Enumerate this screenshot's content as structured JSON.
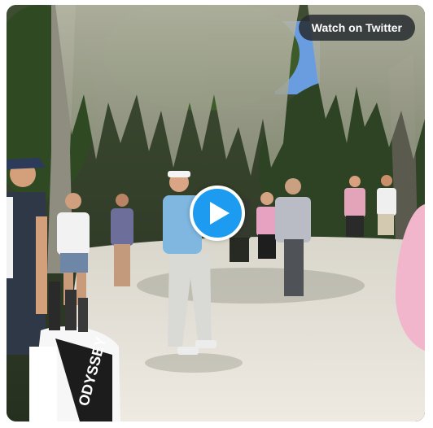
{
  "embed": {
    "watch_label": "Watch on Twitter"
  },
  "player": {
    "play_icon": "play-icon",
    "accent": "#1d9bf0"
  },
  "scene": {
    "bag_text": "ODYSSEY"
  }
}
